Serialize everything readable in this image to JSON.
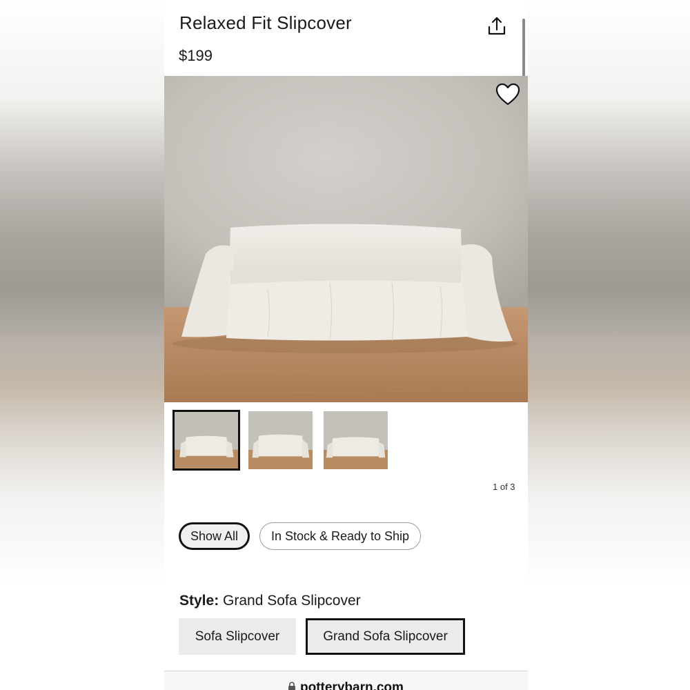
{
  "product": {
    "title": "Relaxed Fit Slipcover",
    "price": "$199"
  },
  "icons": {
    "share": "share-upload-icon",
    "favorite": "heart-outline-icon",
    "lock": "lock-icon"
  },
  "gallery": {
    "counter": "1 of 3",
    "active_index": 1,
    "thumbnail_count": 3
  },
  "filters": {
    "show_all": "Show All",
    "in_stock": "In Stock & Ready to Ship",
    "selected": "Show All"
  },
  "style": {
    "label": "Style:",
    "value": "Grand Sofa Slipcover",
    "options": [
      "Sofa Slipcover",
      "Grand Sofa Slipcover"
    ],
    "selected": "Grand Sofa Slipcover"
  },
  "browser": {
    "url": "potterybarn.com"
  },
  "colors": {
    "wall": "#c5c2bd",
    "floor": "#b8865c",
    "slipcover": "#eeebe5",
    "selected_border": "#111111"
  }
}
